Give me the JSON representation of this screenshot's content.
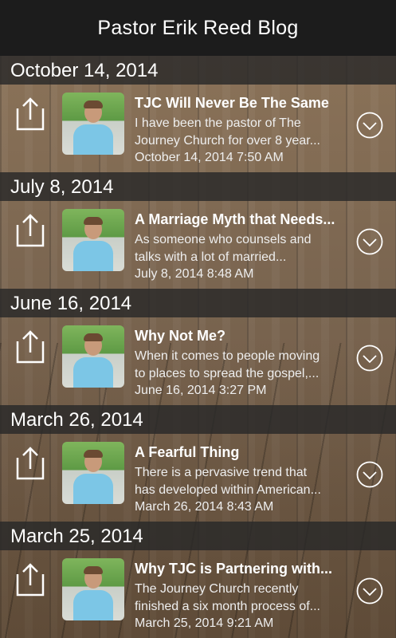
{
  "header": {
    "title": "Pastor Erik Reed Blog"
  },
  "sections": [
    {
      "date": "October 14, 2014",
      "post": {
        "title": "TJC Will Never Be The Same",
        "snippet_line1": "I have been the pastor of The",
        "snippet_line2": "Journey Church for over 8 year...",
        "timestamp": "October 14, 2014 7:50 AM"
      }
    },
    {
      "date": "July 8, 2014",
      "post": {
        "title": "A Marriage Myth that Needs...",
        "snippet_line1": "As someone who counsels and",
        "snippet_line2": "talks with a lot of married...",
        "timestamp": "July 8, 2014 8:48 AM"
      }
    },
    {
      "date": "June 16, 2014",
      "post": {
        "title": "Why Not Me?",
        "snippet_line1": "When it comes to people moving",
        "snippet_line2": "to places to spread the gospel,...",
        "timestamp": "June 16, 2014 3:27 PM"
      }
    },
    {
      "date": "March 26, 2014",
      "post": {
        "title": "A Fearful Thing",
        "snippet_line1": "There is a pervasive trend that",
        "snippet_line2": "has developed within American...",
        "timestamp": "March 26, 2014 8:43 AM"
      }
    },
    {
      "date": "March 25, 2014",
      "post": {
        "title": "Why TJC is Partnering with...",
        "snippet_line1": "The Journey Church recently",
        "snippet_line2": "finished a six month process of...",
        "timestamp": "March 25, 2014 9:21 AM"
      }
    }
  ],
  "icons": {
    "share": "share-icon",
    "expand": "chevron-down-circle-icon",
    "thumbnail": "author-photo"
  },
  "colors": {
    "header_bg": "#1c1c1c",
    "section_bg": "#282828",
    "text": "#ffffff"
  }
}
